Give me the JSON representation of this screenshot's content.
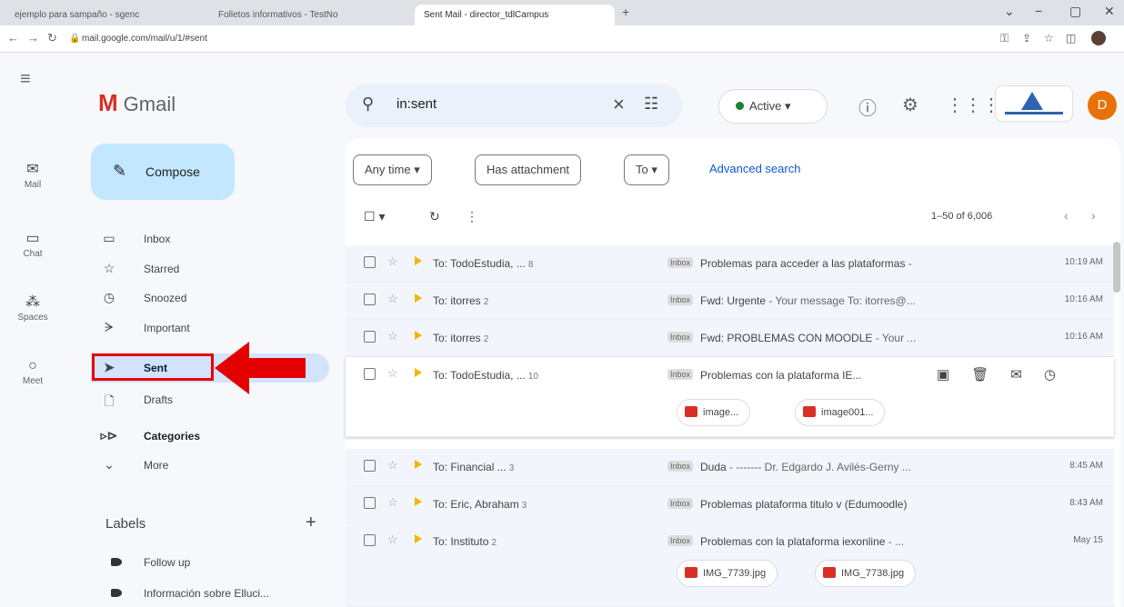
{
  "browser": {
    "tabs": [
      {
        "label": "ejemplo para sampaño - sgenc",
        "active": false
      },
      {
        "label": "Folletos informativos - TestNo",
        "active": false
      },
      {
        "label": "Sent Mail - director_tdlCampus",
        "active": true
      }
    ],
    "url": "mail.google.com/mail/u/1/#sent"
  },
  "rail": {
    "items": [
      {
        "label": "Mail",
        "icon": "mail-icon"
      },
      {
        "label": "Chat",
        "icon": "chat-icon"
      },
      {
        "label": "Spaces",
        "icon": "spaces-icon"
      },
      {
        "label": "Meet",
        "icon": "meet-icon"
      }
    ]
  },
  "header": {
    "logo_text": "Gmail",
    "search_value": "in:sent",
    "status": "Active",
    "avatar_letter": "D"
  },
  "sidebar": {
    "compose_label": "Compose",
    "items": [
      {
        "label": "Inbox",
        "icon": "inbox-icon"
      },
      {
        "label": "Starred",
        "icon": "star-icon"
      },
      {
        "label": "Snoozed",
        "icon": "clock-icon"
      },
      {
        "label": "Important",
        "icon": "important-icon"
      },
      {
        "label": "Sent",
        "icon": "send-icon"
      },
      {
        "label": "Drafts",
        "icon": "draft-icon"
      },
      {
        "label": "Categories",
        "icon": "label-icon"
      },
      {
        "label": "More",
        "icon": "chevron-down-icon"
      }
    ],
    "labels_heading": "Labels",
    "labels": [
      {
        "label": "Follow up"
      },
      {
        "label": "Información sobre Elluci..."
      }
    ]
  },
  "filters": {
    "chips": [
      "Any time",
      "Has attachment",
      "To"
    ],
    "advanced": "Advanced search"
  },
  "toolbar": {
    "pager": "1–50 of 6,006"
  },
  "emails": [
    {
      "to": "To: TodoEstudia, ...",
      "count": "8",
      "badge": "Inbox",
      "subject": "Problemas para acceder a las plataformas",
      "snippet": " -",
      "time": "10:19 AM"
    },
    {
      "to": "To: itorres",
      "count": "2",
      "badge": "Inbox",
      "subject": "Fwd: Urgente",
      "snippet": " - Your message To: itorres@...",
      "time": "10:16 AM"
    },
    {
      "to": "To: itorres",
      "count": "2",
      "badge": "Inbox",
      "subject": "Fwd: PROBLEMAS CON MOODLE",
      "snippet": " - Your ...",
      "time": "10:16 AM"
    },
    {
      "to": "To: TodoEstudia, ...",
      "count": "10",
      "badge": "Inbox",
      "subject": "Problemas con la plataforma IE...",
      "snippet": "",
      "time": "",
      "attachments": [
        "image...",
        "image001..."
      ]
    },
    {
      "to": "To: Financial ...",
      "count": "3",
      "badge": "Inbox",
      "subject": "Duda",
      "snippet": " - ------- Dr. Edgardo J. Avilés-Gerny ...",
      "time": "8:45 AM"
    },
    {
      "to": "To: Eric, Abraham",
      "count": "3",
      "badge": "Inbox",
      "subject": "Problemas plataforma titulo v (Edumoodle)",
      "snippet": "",
      "time": "8:43 AM"
    },
    {
      "to": "To: Instituto",
      "count": "2",
      "badge": "Inbox",
      "subject": "Problemas con la plataforma iexonline",
      "snippet": " - ...",
      "time": "May 15",
      "attachments": [
        "IMG_7739.jpg",
        "IMG_7738.jpg"
      ]
    }
  ],
  "colors": {
    "highlight": "#e50000",
    "compose_bg": "#c2e7ff",
    "selected_nav": "#d3e3fd"
  }
}
